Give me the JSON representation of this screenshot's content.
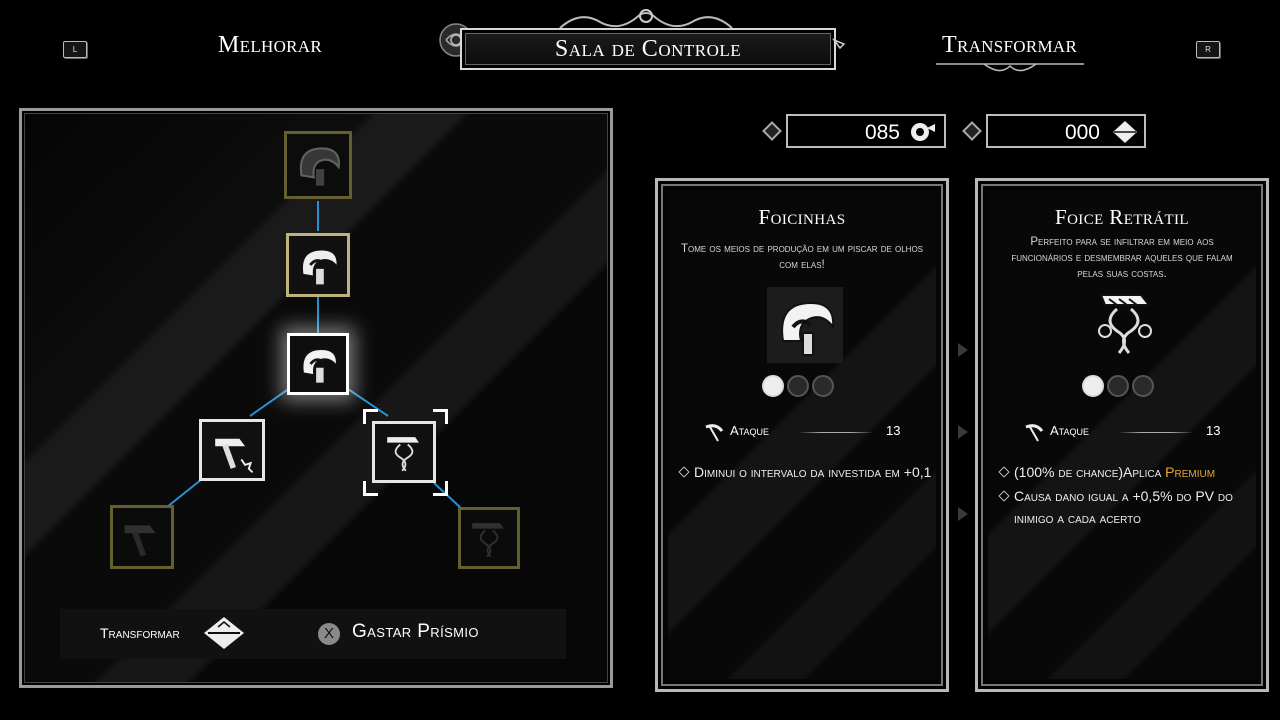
{
  "header": {
    "left_key": "L",
    "left_tab": "Melhorar",
    "title": "Sala de Controle",
    "right_tab": "Transformar",
    "right_key": "R"
  },
  "tree": {
    "footer_left_label": "Transformar",
    "footer_action_button": "X",
    "footer_action_label": "Gastar Prísmio",
    "line_color": "#2a8fd0"
  },
  "currency": {
    "a": {
      "value": "085",
      "icon": "bell-horn-icon"
    },
    "b": {
      "value": "000",
      "icon": "prism-icon"
    }
  },
  "cards": {
    "left": {
      "title": "Foicinhas",
      "description": "Tome os meios de produção em um piscar de olhos com elas!",
      "stat_label": "Ataque",
      "stat_value": "13",
      "bullets": [
        "Diminui o intervalo da investida em +0,1"
      ],
      "slots_filled": 1,
      "slots_total": 3
    },
    "right": {
      "title": "Foice Retrátil",
      "description": "Perfeito para se infiltrar em meio aos funcionários e desmembrar aqueles que falam pelas suas costas.",
      "stat_label": "Ataque",
      "stat_value": "13",
      "bullet1_pre": "(100% de chance)Aplica ",
      "bullet1_accent": "Premium",
      "bullet2": "Causa dano igual a +0,5% do PV do inimigo a cada acerto",
      "slots_filled": 1,
      "slots_total": 3,
      "accent_color": "#e8a62a"
    }
  }
}
